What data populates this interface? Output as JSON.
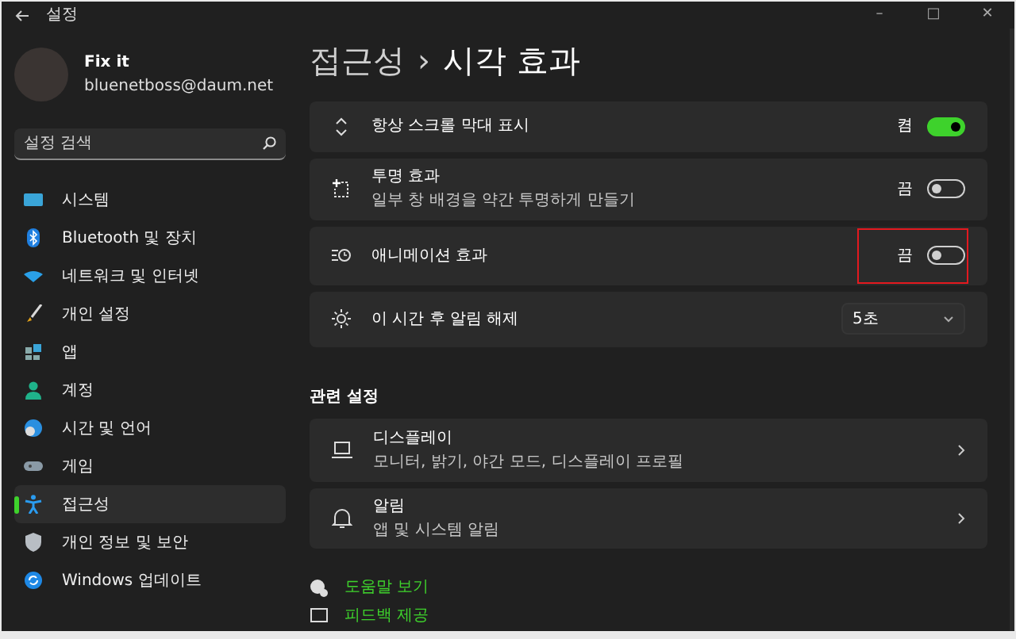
{
  "window": {
    "title": "설정",
    "controls": [
      "–",
      "□",
      "✕"
    ]
  },
  "profile": {
    "name": "Fix it",
    "email": "bluenetboss@daum.net"
  },
  "search": {
    "placeholder": "설정 검색"
  },
  "sidebar": {
    "items": [
      {
        "label": "시스템",
        "selected": false
      },
      {
        "label": "Bluetooth 및 장치",
        "selected": false
      },
      {
        "label": "네트워크 및 인터넷",
        "selected": false
      },
      {
        "label": "개인 설정",
        "selected": false
      },
      {
        "label": "앱",
        "selected": false
      },
      {
        "label": "계정",
        "selected": false
      },
      {
        "label": "시간 및 언어",
        "selected": false
      },
      {
        "label": "게임",
        "selected": false
      },
      {
        "label": "접근성",
        "selected": true
      },
      {
        "label": "개인 정보 및 보안",
        "selected": false
      },
      {
        "label": "Windows 업데이트",
        "selected": false
      }
    ]
  },
  "breadcrumb": {
    "parent": "접근성",
    "separator": "›",
    "current": "시각 효과"
  },
  "settings": [
    {
      "kind": "toggle",
      "title": "항상 스크롤 막대 표시",
      "state_label": "켬",
      "on": true,
      "highlighted": false
    },
    {
      "kind": "toggle",
      "title": "투명 효과",
      "description": "일부 창 배경을 약간 투명하게 만들기",
      "state_label": "끔",
      "on": false,
      "highlighted": false
    },
    {
      "kind": "toggle",
      "title": "애니메이션 효과",
      "state_label": "끔",
      "on": false,
      "highlighted": true
    },
    {
      "kind": "dropdown",
      "title": "이 시간 후 알림 해제",
      "value": "5초",
      "highlighted": false
    }
  ],
  "related": {
    "heading": "관련 설정",
    "items": [
      {
        "title": "디스플레이",
        "description": "모니터, 밝기, 야간 모드, 디스플레이 프로필"
      },
      {
        "title": "알림",
        "description": "앱 및 시스템 알림"
      }
    ]
  },
  "links": [
    "도움말 보기",
    "피드백 제공"
  ]
}
